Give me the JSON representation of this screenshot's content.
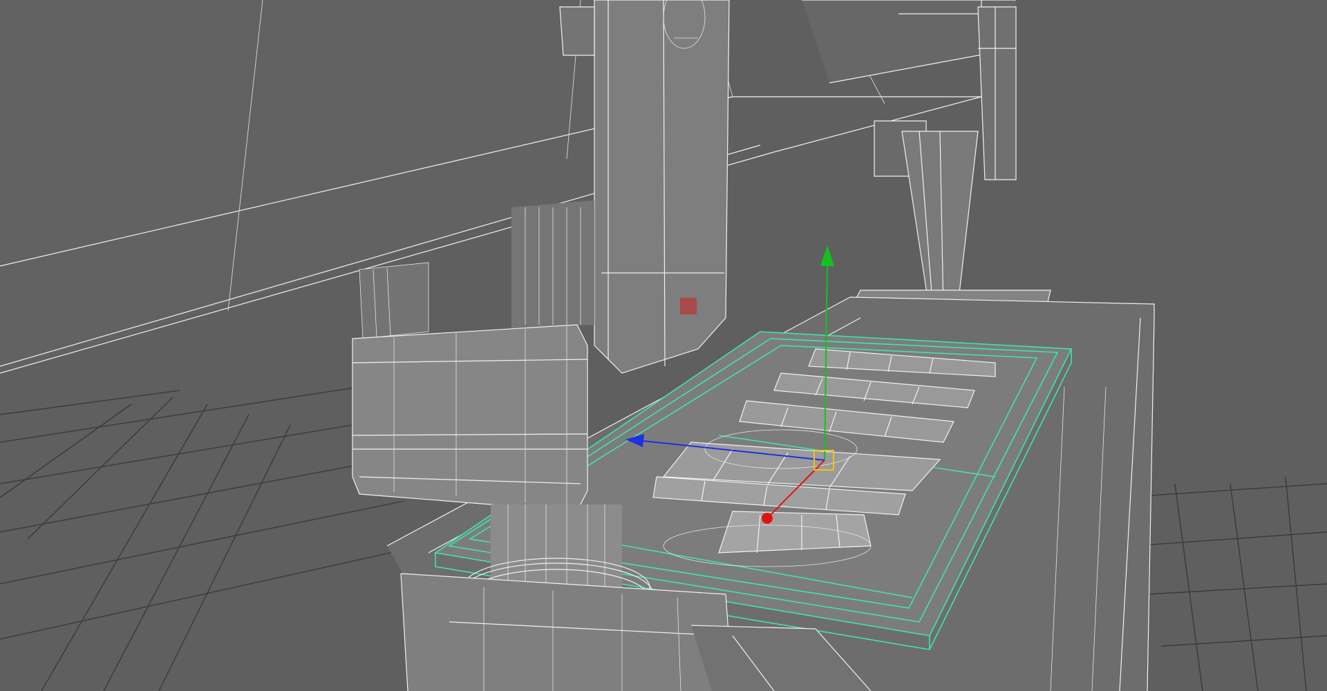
{
  "viewport": {
    "background": "#5e5e5e",
    "wire_color": "#f2f2f2",
    "selection_color": "#3ee6a6",
    "grid_color": "#3a3a3a"
  },
  "gizmo": {
    "axes": [
      {
        "axis": "y",
        "color": "#14c21e"
      },
      {
        "axis": "z",
        "color": "#1f2fe6"
      },
      {
        "axis": "x",
        "color": "#e01414"
      }
    ],
    "center_color": "#f1c40f"
  },
  "marker_color": "#c0392b"
}
